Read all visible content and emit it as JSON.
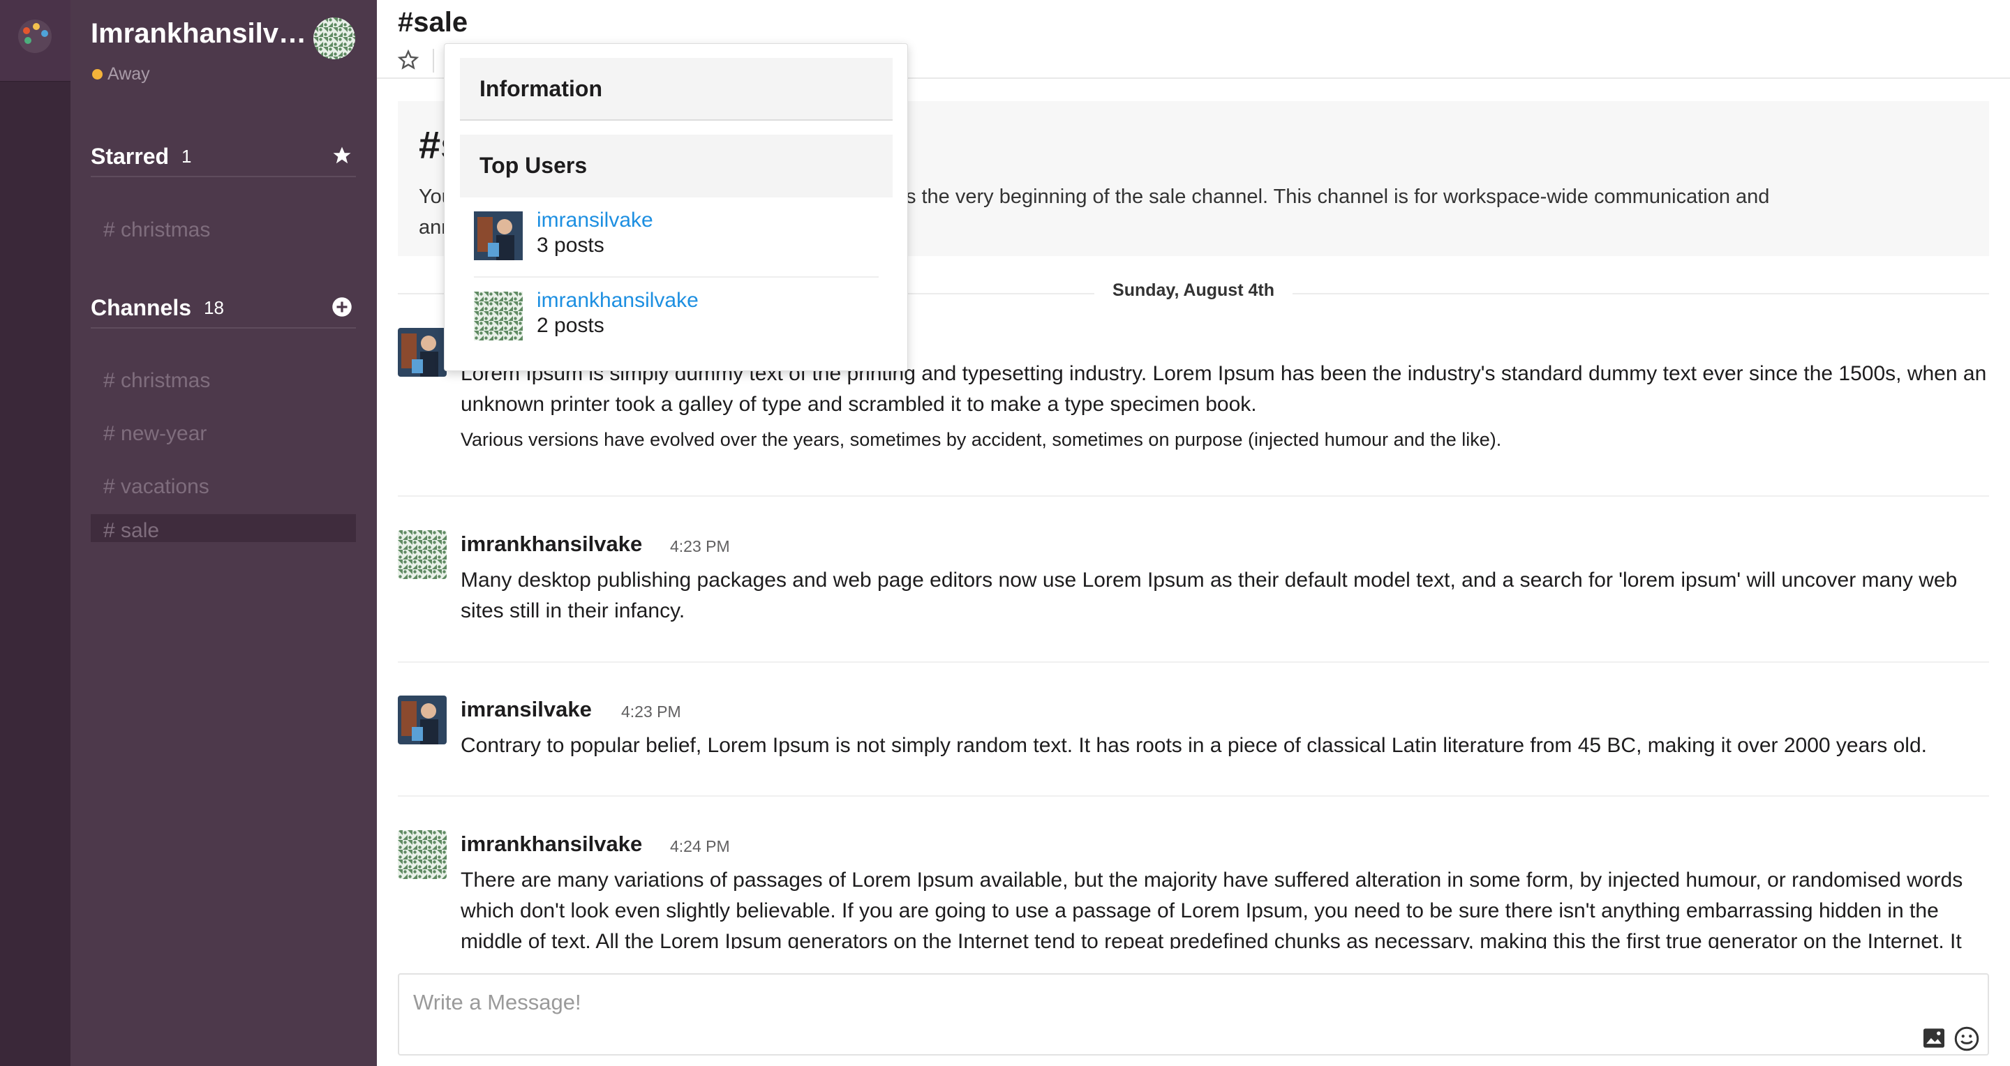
{
  "workspace": {
    "user_name": "Imrankhansilvake",
    "status": "Away",
    "away_color": "#f4b33a"
  },
  "sidebar": {
    "starred": {
      "title": "Starred",
      "count": "1",
      "action_icon": "star-icon",
      "items": [
        {
          "label": "# christmas"
        }
      ]
    },
    "channels": {
      "title": "Channels",
      "count": "18",
      "action_icon": "add-circle-icon",
      "items": [
        {
          "label": "# christmas"
        },
        {
          "label": "# new-year"
        },
        {
          "label": "# vacations"
        },
        {
          "label": "# sale",
          "active": true
        }
      ]
    }
  },
  "channel": {
    "title": "#sale",
    "intro_title": "#sale",
    "intro_text_left": "You",
    "intro_text_right": "s is the very beginning of the sale channel. This channel is for workspace-wide communication and",
    "intro_text_line2": "ann"
  },
  "day_divider": "Sunday, August 4th",
  "messages": [
    {
      "author": "",
      "time": "",
      "avatar": "photo",
      "lines": [
        "Lorem Ipsum is simply dummy text of the printing and typesetting industry. Lorem Ipsum has been the industry's standard dummy text ever since the 1500s, when an unknown printer took a galley of type and scrambled it to make a type specimen book."
      ],
      "extra": "Various versions have evolved over the years, sometimes by accident, sometimes on purpose (injected humour and the like)."
    },
    {
      "author": "imrankhansilvake",
      "time": "4:23 PM",
      "avatar": "pattern",
      "lines": [
        "Many desktop publishing packages and web page editors now use Lorem Ipsum as their default model text, and a search for 'lorem ipsum' will uncover many web sites still in their infancy."
      ]
    },
    {
      "author": "imransilvake",
      "time": "4:23 PM",
      "avatar": "photo",
      "lines": [
        "Contrary to popular belief, Lorem Ipsum is not simply random text. It has roots in a piece of classical Latin literature from 45 BC, making it over 2000 years old."
      ]
    },
    {
      "author": "imrankhansilvake",
      "time": "4:24 PM",
      "avatar": "pattern",
      "lines": [
        "There are many variations of passages of Lorem Ipsum available, but the majority have suffered alteration in some form, by injected humour, or randomised words which don't look even slightly believable. If you are going to use a passage of Lorem Ipsum, you need to be sure there isn't anything embarrassing hidden in the middle of text. All the Lorem Ipsum generators on the Internet tend to repeat predefined chunks as necessary, making this the first true generator on the Internet. It"
      ]
    }
  ],
  "composer": {
    "placeholder": "Write a Message!",
    "icons": [
      "image-icon",
      "emoji-icon"
    ]
  },
  "popover": {
    "information_title": "Information",
    "top_users_title": "Top Users",
    "top_users": [
      {
        "name": "imransilvake",
        "posts": "3 posts",
        "avatar": "photo"
      },
      {
        "name": "imrankhansilvake",
        "posts": "2 posts",
        "avatar": "pattern"
      }
    ]
  },
  "colors": {
    "sidebar_bg": "#4d394b",
    "rail_bg": "#3a2839",
    "link": "#1d8fe1"
  }
}
